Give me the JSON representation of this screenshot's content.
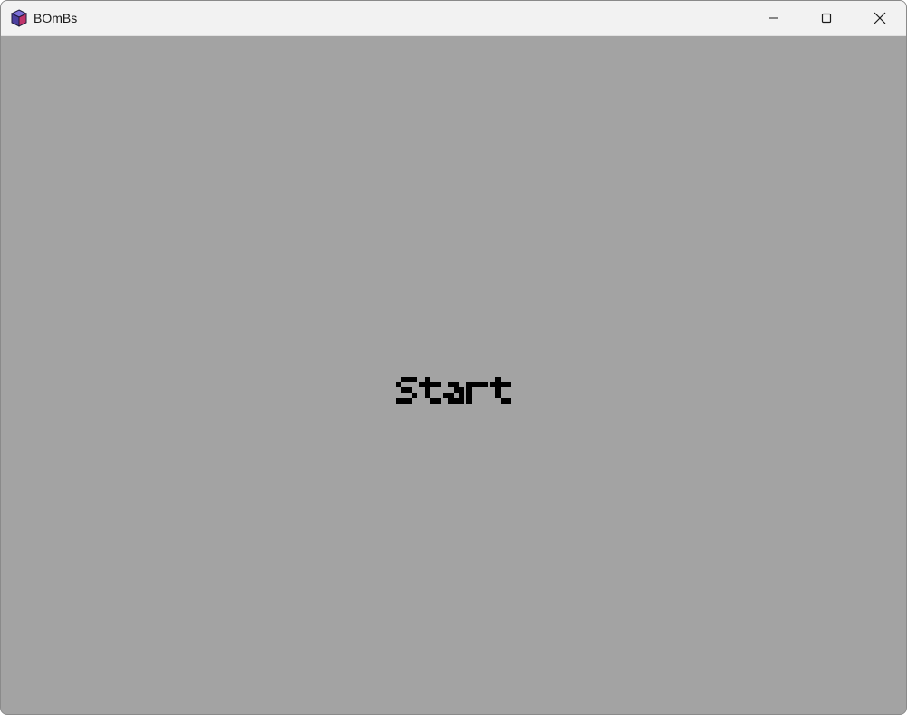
{
  "window": {
    "title": "BOmBs",
    "controls": {
      "minimize_icon": "minimize-icon",
      "maximize_icon": "maximize-icon",
      "close_icon": "close-icon"
    }
  },
  "game": {
    "background_color": "#a3a3a3",
    "start_label": "Start",
    "start_color": "#000000"
  }
}
